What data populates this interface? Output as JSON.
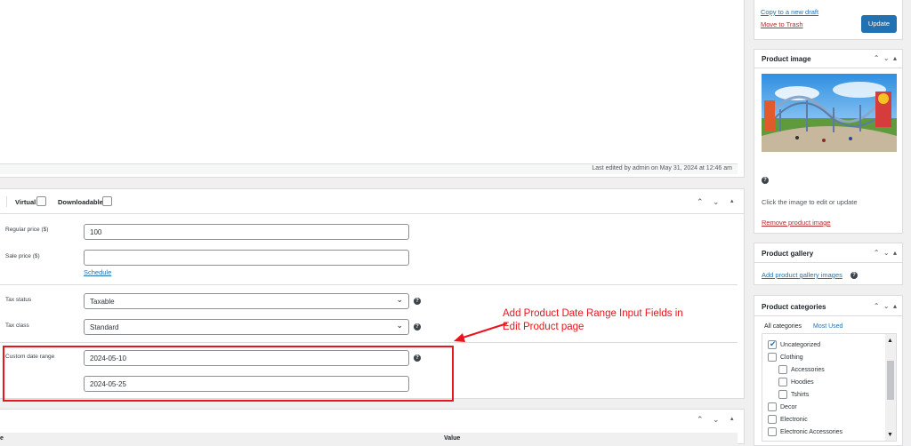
{
  "editor": {
    "last_edited": "Last edited by admin on May 31, 2024 at 12:46 am"
  },
  "product_data": {
    "virtual_label": "Virtual:",
    "downloadable_label": "Downloadable:",
    "regular_price_label": "Regular price ($)",
    "regular_price_value": "100",
    "sale_price_label": "Sale price ($)",
    "sale_price_value": "",
    "schedule_link": "Schedule",
    "tax_status_label": "Tax status",
    "tax_status_value": "Taxable",
    "tax_class_label": "Tax class",
    "tax_class_value": "Standard",
    "custom_date_label": "Custom date range",
    "date_start": "2024-05-10",
    "date_end": "2024-05-25",
    "help_glyph": "?"
  },
  "annotation": {
    "line1": "Add Product Date Range Input Fields in",
    "line2": "Edit Product page"
  },
  "attributes": {
    "col_name_partial": "e",
    "col_value": "Value"
  },
  "publish": {
    "copy_draft": "Copy to a new draft",
    "move_trash": "Move to Trash",
    "update_button": "Update"
  },
  "product_image": {
    "title": "Product image",
    "hint": "Click the image to edit or update",
    "remove_link": "Remove product image"
  },
  "product_gallery": {
    "title": "Product gallery",
    "add_link": "Add product gallery images"
  },
  "product_categories": {
    "title": "Product categories",
    "tab_all": "All categories",
    "tab_most_used": "Most Used",
    "items": [
      {
        "label": "Uncategorized",
        "checked": true,
        "indent": 0
      },
      {
        "label": "Clothing",
        "checked": false,
        "indent": 0
      },
      {
        "label": "Accessories",
        "checked": false,
        "indent": 1
      },
      {
        "label": "Hoodies",
        "checked": false,
        "indent": 1
      },
      {
        "label": "Tshirts",
        "checked": false,
        "indent": 1
      },
      {
        "label": "Decor",
        "checked": false,
        "indent": 0
      },
      {
        "label": "Electronic",
        "checked": false,
        "indent": 0
      },
      {
        "label": "Electronic Accessories",
        "checked": false,
        "indent": 0
      }
    ]
  },
  "colors": {
    "accent": "#2271b1",
    "annotation_red": "#e8151c",
    "trash_red": "#b32d2e"
  }
}
